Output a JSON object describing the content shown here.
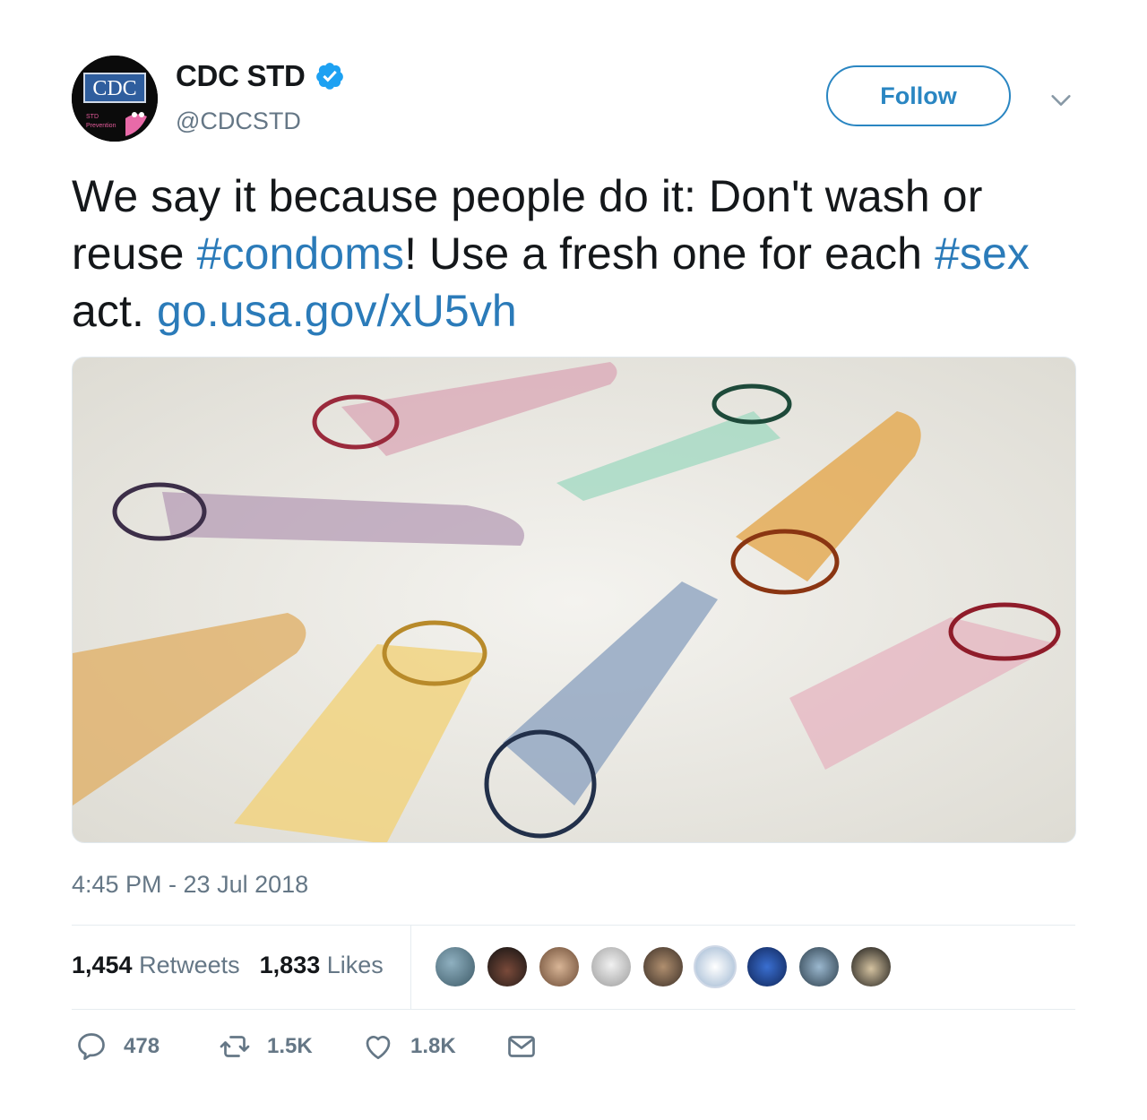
{
  "tweet": {
    "author_name": "CDC STD",
    "author_handle": "@CDCSTD",
    "avatar_logo_text": "CDC",
    "avatar_sub_text": "STD Prevention",
    "follow_label": "Follow",
    "text_segments": [
      {
        "text": "We say it because people do it: Don't wash or reuse ",
        "type": "text"
      },
      {
        "text": "#condoms",
        "type": "hashtag"
      },
      {
        "text": "! Use a fresh one for each ",
        "type": "text"
      },
      {
        "text": "#sex",
        "type": "hashtag"
      },
      {
        "text": " act. ",
        "type": "text"
      },
      {
        "text": " go.usa.gov/xU5vh",
        "type": "link"
      }
    ],
    "timestamp": "4:45 PM - 23 Jul 2018",
    "retweets_count": "1,454",
    "retweets_label": "Retweets",
    "likes_count": "1,833",
    "likes_label": "Likes",
    "actions": {
      "reply_count": "478",
      "retweet_count": "1.5K",
      "like_count": "1.8K"
    },
    "colors": {
      "link": "#2b7bb9",
      "verified": "#1da1f2",
      "follow_border": "#2a86c2",
      "muted": "#657786"
    },
    "liker_avatar_colors": [
      "#5a7a8a",
      "#2b2b2b",
      "#9a7b62",
      "#cfcfcf",
      "#6d5a4c",
      "#dfe8f2",
      "#1d3f8a",
      "#5f7d93",
      "#222222"
    ]
  }
}
